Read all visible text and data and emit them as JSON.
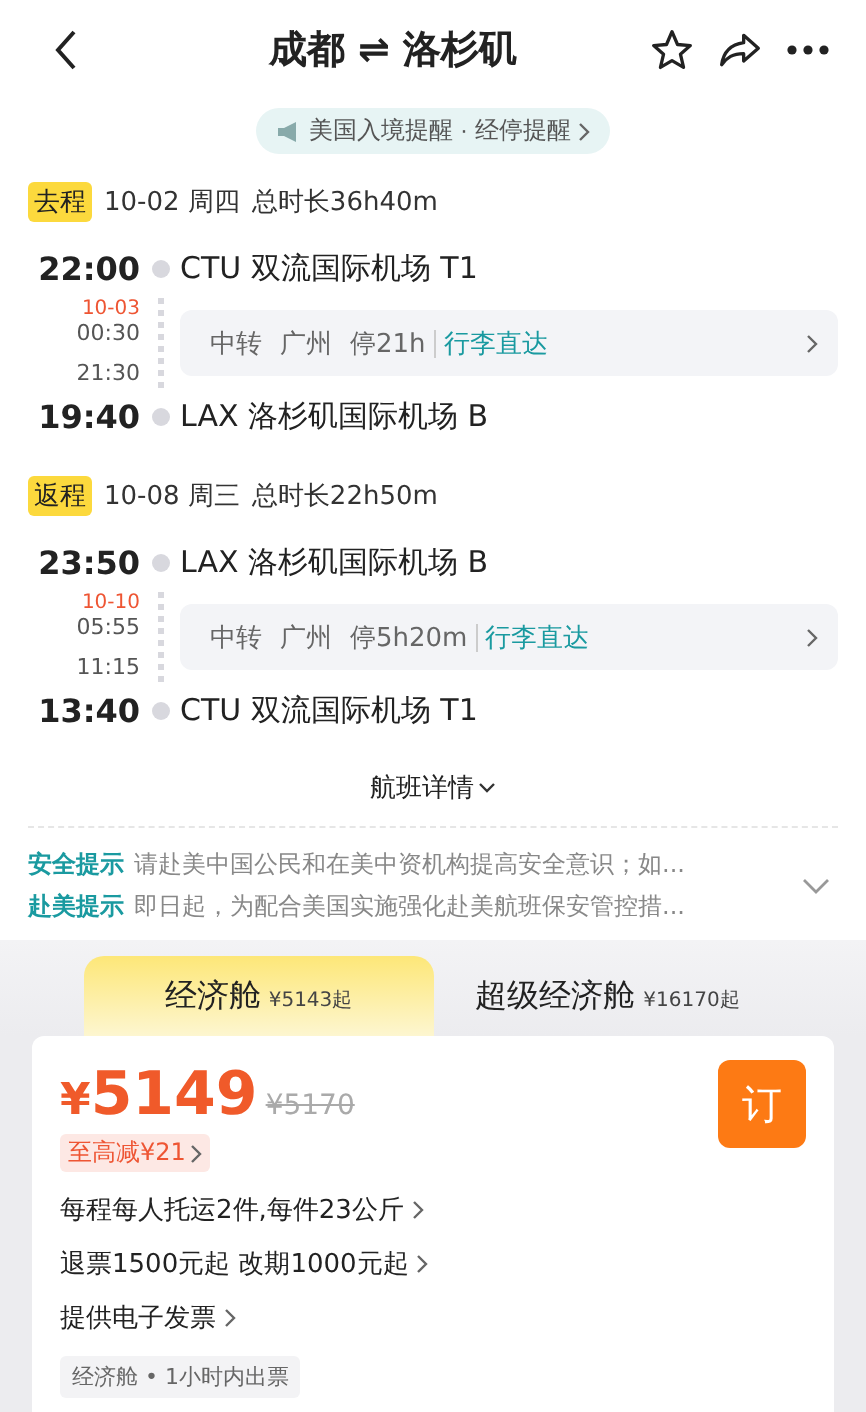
{
  "header": {
    "title": "成都 ⇌ 洛杉矶"
  },
  "notice": {
    "text": "美国入境提醒 · 经停提醒"
  },
  "legs": [
    {
      "tag": "去程",
      "date": "10-02 周四",
      "duration": "总时长36h40m",
      "depart": {
        "time": "22:00",
        "airport": "CTU 双流国际机场 T1"
      },
      "transfer": {
        "next_day": "10-03",
        "arrive_time": "00:30",
        "depart_time": "21:30",
        "label": "中转",
        "city": "广州",
        "stay": "停21h",
        "baggage": "行李直达"
      },
      "arrive": {
        "time": "19:40",
        "airport": "LAX 洛杉矶国际机场 B"
      }
    },
    {
      "tag": "返程",
      "date": "10-08 周三",
      "duration": "总时长22h50m",
      "depart": {
        "time": "23:50",
        "airport": "LAX 洛杉矶国际机场 B"
      },
      "transfer": {
        "next_day": "10-10",
        "arrive_time": "05:55",
        "depart_time": "11:15",
        "label": "中转",
        "city": "广州",
        "stay": "停5h20m",
        "baggage": "行李直达"
      },
      "arrive": {
        "time": "13:40",
        "airport": "CTU 双流国际机场 T1"
      }
    }
  ],
  "details_link": "航班详情",
  "tips": [
    {
      "label": "安全提示",
      "text": "请赴美中国公民和在美中资机构提高安全意识；如..."
    },
    {
      "label": "赴美提示",
      "text": "即日起，为配合美国实施强化赴美航班保安管控措..."
    }
  ],
  "cabin_tabs": [
    {
      "name": "经济舱",
      "price": "¥5143起",
      "selected": true
    },
    {
      "name": "超级经济舱",
      "price": "¥16170起",
      "selected": false
    }
  ],
  "offer": {
    "currency": "¥",
    "price": "5149",
    "original_price": "¥5170",
    "discount": "至高减¥21",
    "book": "订",
    "perks": [
      "每程每人托运2件,每件23公斤",
      "退票1500元起 改期1000元起",
      "提供电子发票"
    ],
    "tag": "经济舱 • 1小时内出票"
  }
}
